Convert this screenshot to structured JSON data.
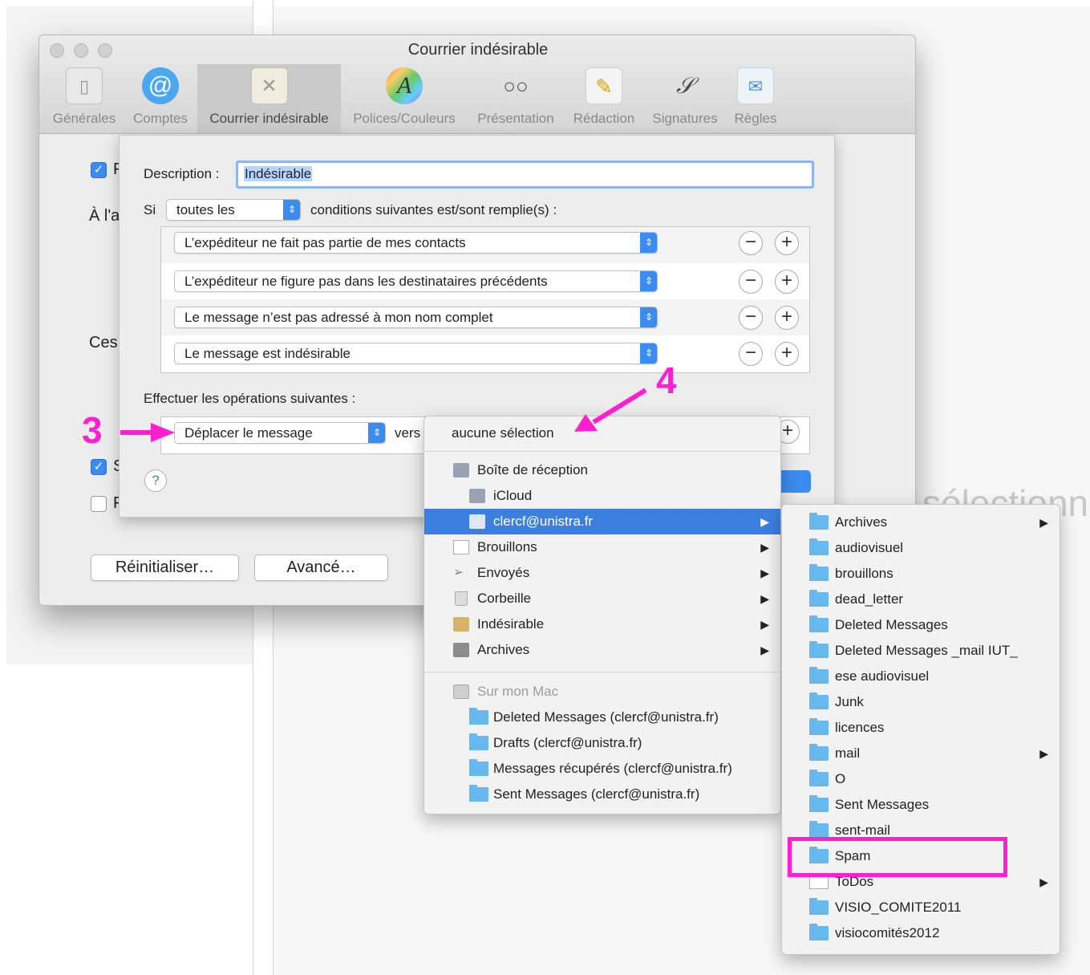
{
  "window": {
    "title": "Courrier indésirable",
    "toolbar": [
      {
        "label": "Générales",
        "icon": "device-icon"
      },
      {
        "label": "Comptes",
        "icon": "at-sign-icon"
      },
      {
        "label": "Courrier indésirable",
        "icon": "junk-bin-icon",
        "selected": true
      },
      {
        "label": "Polices/Couleurs",
        "icon": "fonts-colors-icon"
      },
      {
        "label": "Présentation",
        "icon": "glasses-icon"
      },
      {
        "label": "Rédaction",
        "icon": "pencil-icon"
      },
      {
        "label": "Signatures",
        "icon": "signature-icon"
      },
      {
        "label": "Règles",
        "icon": "rules-envelope-icon"
      }
    ],
    "left_fragments": {
      "row1": "F",
      "row2": "À l'a",
      "row3": "Ces",
      "row4": "S",
      "row5": "F"
    },
    "reset_button": "Réinitialiser…",
    "advanced_button": "Avancé…"
  },
  "sheet": {
    "description_label": "Description :",
    "description_value": "Indésirable",
    "si_label": "Si",
    "match_popup": "toutes les",
    "conditions_suffix": "conditions suivantes est/sont remplie(s) :",
    "conditions": [
      "L’expéditeur ne fait pas partie de mes contacts",
      "L’expéditeur ne figure pas dans les destinataires précédents",
      "Le message n’est pas adressé à mon nom complet",
      "Le message est indésirable"
    ],
    "actions_label": "Effectuer les opérations suivantes :",
    "action_popup": "Déplacer le message",
    "vers_label": "vers",
    "help": "?"
  },
  "mailbox_menu": {
    "none_item": "aucune sélection",
    "items": [
      {
        "label": "Boîte de réception",
        "icon": "inbox-icon"
      },
      {
        "label": "iCloud",
        "icon": "inbox-icon"
      },
      {
        "label": "clercf@unistra.fr",
        "icon": "inbox-icon",
        "highlighted": true
      },
      {
        "label": "Brouillons",
        "icon": "draft-icon"
      },
      {
        "label": "Envoyés",
        "icon": "sent-icon"
      },
      {
        "label": "Corbeille",
        "icon": "trash-icon"
      },
      {
        "label": "Indésirable",
        "icon": "junk-icon"
      },
      {
        "label": "Archives",
        "icon": "archive-box-icon"
      }
    ],
    "local_header": "Sur mon Mac",
    "local_items": [
      "Deleted Messages (clercf@unistra.fr)",
      "Drafts (clercf@unistra.fr)",
      "Messages récupérés (clercf@unistra.fr)",
      "Sent Messages (clercf@unistra.fr)"
    ]
  },
  "submenu": {
    "items": [
      "Archives",
      "audiovisuel",
      "brouillons",
      "dead_letter",
      "Deleted Messages",
      "Deleted Messages _mail IUT_",
      "ese audiovisuel",
      "Junk",
      "licences",
      "mail",
      "O",
      "Sent Messages",
      "sent-mail",
      "Spam",
      "ToDos",
      "VISIO_COMITE2011",
      "visiocomités2012"
    ]
  },
  "annotations": {
    "step3": "3",
    "step4": "4",
    "color": "#ff1fd0"
  },
  "background": {
    "ghost_text": "sélectionn"
  }
}
